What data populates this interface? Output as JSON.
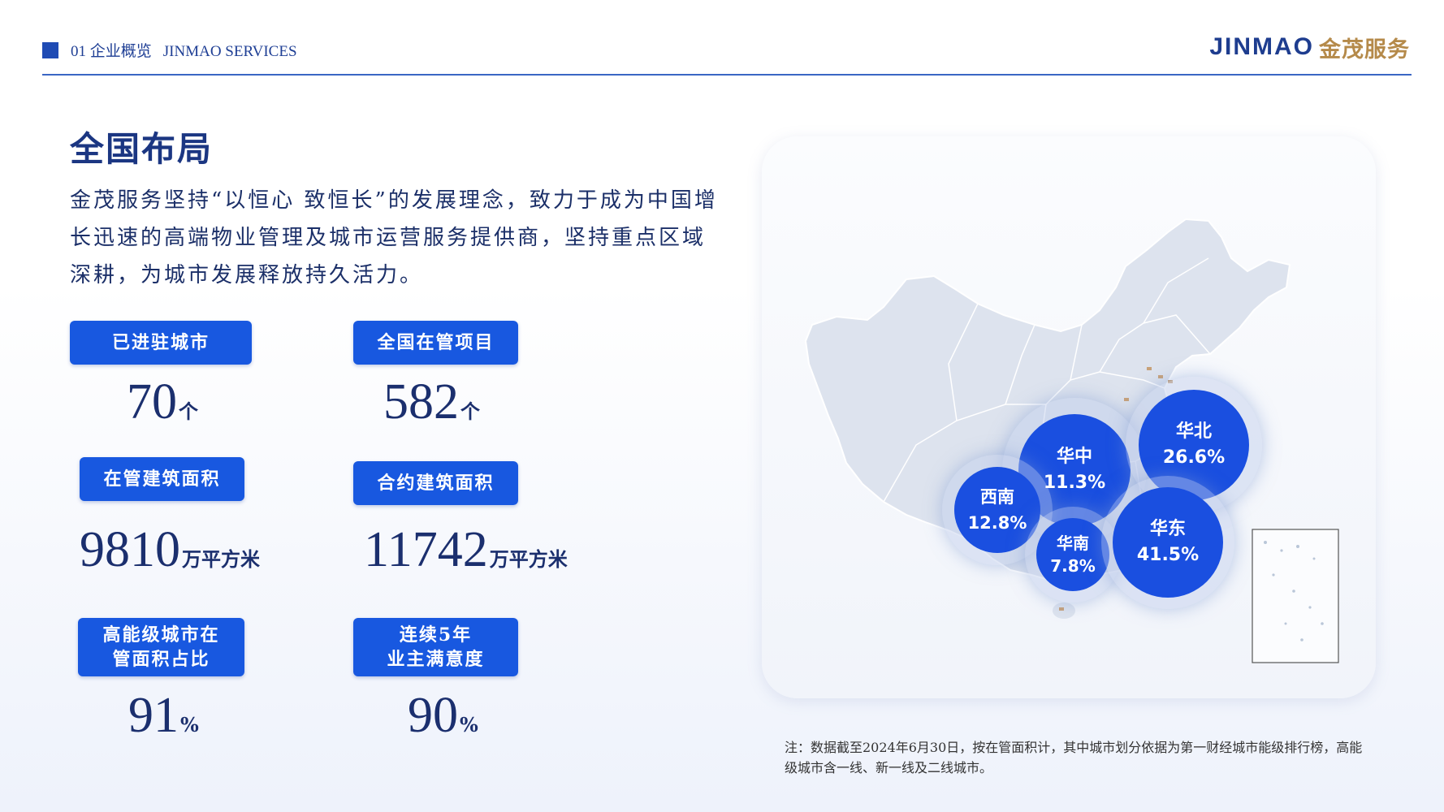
{
  "header": {
    "section": "01 企业概览",
    "subtitle": "JINMAO SERVICES",
    "logo_en": "JINMAO",
    "logo_cn": "金茂服务"
  },
  "title": "全国布局",
  "intro": "金茂服务坚持“以恒心 致恒长”的发展理念，致力于成为中国增长迅速的高端物业管理及城市运营服务提供商，坚持重点区域深耕，为城市发展释放持久活力。",
  "stats": [
    {
      "label": "已进驻城市",
      "value": "70",
      "unit": "个"
    },
    {
      "label": "全国在管项目",
      "value": "582",
      "unit": "个"
    },
    {
      "label": "在管建筑面积",
      "value": "9810",
      "unit": "万平方米"
    },
    {
      "label": "合约建筑面积",
      "value": "11742",
      "unit": "万平方米"
    },
    {
      "label_line1": "高能级城市在",
      "label_line2": "管面积占比",
      "value": "91",
      "unit": "%"
    },
    {
      "label_line1": "连续5年",
      "label_line2": "业主满意度",
      "value": "90",
      "unit": "%"
    }
  ],
  "regions": [
    {
      "name": "华北",
      "share": "26.6%"
    },
    {
      "name": "华中",
      "share": "11.3%"
    },
    {
      "name": "西南",
      "share": "12.8%"
    },
    {
      "name": "华南",
      "share": "7.8%"
    },
    {
      "name": "华东",
      "share": "41.5%"
    }
  ],
  "note": "注：数据截至2024年6月30日，按在管面积计，其中城市划分依据为第一财经城市能级排行榜，高能级城市含一线、新一线及二线城市。",
  "colors": {
    "accent": "#1858e0",
    "title": "#1b3682",
    "bubble": "#1a4fe0",
    "logo_gold": "#b58a4a"
  }
}
